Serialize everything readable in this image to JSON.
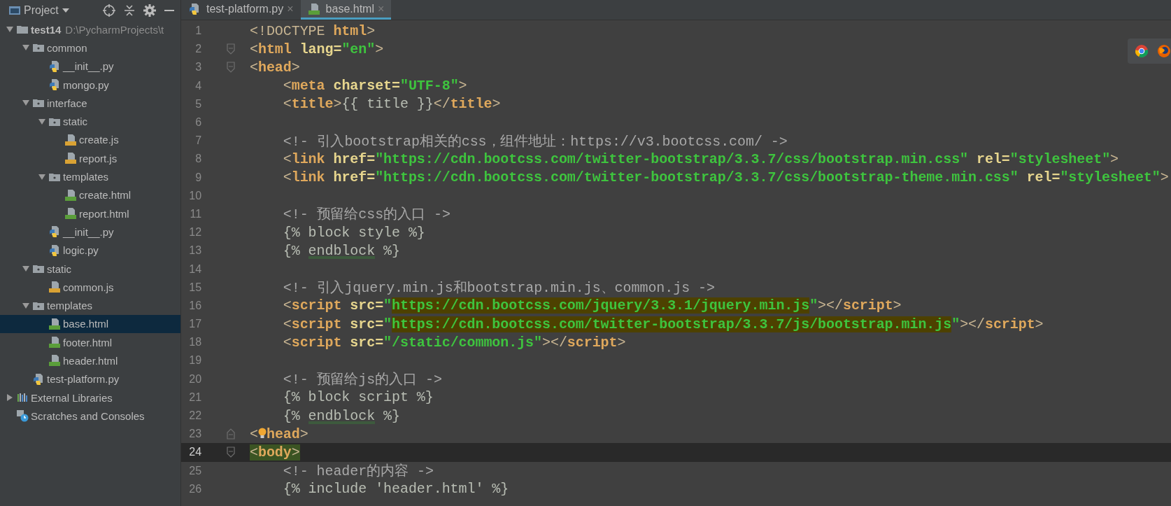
{
  "project_panel": {
    "title": "Project",
    "tree": [
      {
        "name": "test14",
        "kind": "root",
        "path": "D:\\PycharmProjects\\t",
        "expanded": true,
        "selected": false,
        "children": [
          {
            "name": "common",
            "kind": "folder",
            "expanded": true,
            "selected": false,
            "children": [
              {
                "name": "__init__.py",
                "kind": "py",
                "selected": false
              },
              {
                "name": "mongo.py",
                "kind": "py",
                "selected": false
              }
            ]
          },
          {
            "name": "interface",
            "kind": "folder",
            "expanded": true,
            "selected": false,
            "children": [
              {
                "name": "static",
                "kind": "folder",
                "expanded": true,
                "selected": false,
                "children": [
                  {
                    "name": "create.js",
                    "kind": "js",
                    "selected": false
                  },
                  {
                    "name": "report.js",
                    "kind": "js",
                    "selected": false
                  }
                ]
              },
              {
                "name": "templates",
                "kind": "folder",
                "expanded": true,
                "selected": false,
                "children": [
                  {
                    "name": "create.html",
                    "kind": "html",
                    "selected": false
                  },
                  {
                    "name": "report.html",
                    "kind": "html",
                    "selected": false
                  }
                ]
              },
              {
                "name": "__init__.py",
                "kind": "py",
                "selected": false
              },
              {
                "name": "logic.py",
                "kind": "py",
                "selected": false
              }
            ]
          },
          {
            "name": "static",
            "kind": "folder",
            "expanded": true,
            "selected": false,
            "children": [
              {
                "name": "common.js",
                "kind": "js",
                "selected": false
              }
            ]
          },
          {
            "name": "templates",
            "kind": "folder",
            "expanded": true,
            "selected": false,
            "children": [
              {
                "name": "base.html",
                "kind": "html",
                "selected": true
              },
              {
                "name": "footer.html",
                "kind": "html",
                "selected": false
              },
              {
                "name": "header.html",
                "kind": "html",
                "selected": false
              }
            ]
          },
          {
            "name": "test-platform.py",
            "kind": "py",
            "selected": false
          }
        ]
      },
      {
        "name": "External Libraries",
        "kind": "libraries",
        "expanded": false,
        "selected": false
      },
      {
        "name": "Scratches and Consoles",
        "kind": "scratches",
        "selected": false
      }
    ]
  },
  "editor": {
    "tabs": [
      {
        "label": "test-platform.py",
        "kind": "py",
        "selected": false,
        "close": "×"
      },
      {
        "label": "base.html",
        "kind": "html",
        "selected": true,
        "close": "×"
      }
    ],
    "lines": [
      {
        "number": "1",
        "current": false,
        "kind": "plain",
        "tokens": [
          {
            "text": "<!DOCTYPE ",
            "kind": "doctype"
          },
          {
            "text": "html",
            "kind": "tag"
          },
          {
            "text": ">",
            "kind": "p"
          }
        ]
      },
      {
        "number": "2",
        "current": false,
        "kind": "fold-start",
        "tokens": [
          {
            "text": "<",
            "kind": "p"
          },
          {
            "text": "html",
            "kind": "tag"
          },
          {
            "text": " lang=",
            "kind": "attr"
          },
          {
            "text": "\"en\"",
            "kind": "str"
          },
          {
            "text": ">",
            "kind": "p"
          }
        ]
      },
      {
        "number": "3",
        "current": false,
        "kind": "fold-start",
        "tokens": [
          {
            "text": "<",
            "kind": "p"
          },
          {
            "text": "head",
            "kind": "tag"
          },
          {
            "text": ">",
            "kind": "p"
          }
        ]
      },
      {
        "number": "4",
        "current": false,
        "kind": "plain",
        "tokens": [
          {
            "text": "    <",
            "kind": "p"
          },
          {
            "text": "meta",
            "kind": "tag"
          },
          {
            "text": " charset=",
            "kind": "attr"
          },
          {
            "text": "\"UTF-8\"",
            "kind": "str"
          },
          {
            "text": ">",
            "kind": "p"
          }
        ]
      },
      {
        "number": "5",
        "current": false,
        "kind": "plain",
        "tokens": [
          {
            "text": "    <",
            "kind": "p"
          },
          {
            "text": "title",
            "kind": "tag"
          },
          {
            "text": ">",
            "kind": "p"
          },
          {
            "text": "{{ title }}",
            "kind": "tpl"
          },
          {
            "text": "</",
            "kind": "p"
          },
          {
            "text": "title",
            "kind": "tag"
          },
          {
            "text": ">",
            "kind": "p"
          }
        ]
      },
      {
        "number": "6",
        "current": false,
        "kind": "plain"
      },
      {
        "number": "7",
        "current": false,
        "kind": "plain",
        "tokens": [
          {
            "text": "    <!- 引入bootstrap相关的css，组件地址：https://v3.bootcss.com/ ->",
            "kind": "cmt"
          }
        ]
      },
      {
        "number": "8",
        "current": false,
        "kind": "plain",
        "tokens": [
          {
            "text": "    <",
            "kind": "p"
          },
          {
            "text": "link",
            "kind": "tag"
          },
          {
            "text": " href=",
            "kind": "attr"
          },
          {
            "text": "\"https://cdn.bootcss.com/twitter-bootstrap/3.3.7/css/bootstrap.min.css\"",
            "kind": "str"
          },
          {
            "text": " rel=",
            "kind": "attr"
          },
          {
            "text": "\"stylesheet\"",
            "kind": "str"
          },
          {
            "text": ">",
            "kind": "p"
          }
        ]
      },
      {
        "number": "9",
        "current": false,
        "kind": "plain",
        "tokens": [
          {
            "text": "    <",
            "kind": "p"
          },
          {
            "text": "link",
            "kind": "tag"
          },
          {
            "text": " href=",
            "kind": "attr"
          },
          {
            "text": "\"https://cdn.bootcss.com/twitter-bootstrap/3.3.7/css/bootstrap-theme.min.css\"",
            "kind": "str"
          },
          {
            "text": " rel=",
            "kind": "attr"
          },
          {
            "text": "\"stylesheet\"",
            "kind": "str"
          },
          {
            "text": ">",
            "kind": "p"
          }
        ]
      },
      {
        "number": "10",
        "current": false,
        "kind": "plain"
      },
      {
        "number": "11",
        "current": false,
        "kind": "plain",
        "tokens": [
          {
            "text": "    <!- 预留给css的入口 ->",
            "kind": "cmt"
          }
        ]
      },
      {
        "number": "12",
        "current": false,
        "kind": "plain",
        "tokens": [
          {
            "text": "    {% block style %}",
            "kind": "tpl"
          }
        ]
      },
      {
        "number": "13",
        "current": false,
        "kind": "plain",
        "tokens": [
          {
            "text": "    {% ",
            "kind": "tpl"
          },
          {
            "text": "endblock",
            "kind": "tpl-warn"
          },
          {
            "text": " %}",
            "kind": "tpl"
          }
        ]
      },
      {
        "number": "14",
        "current": false,
        "kind": "plain"
      },
      {
        "number": "15",
        "current": false,
        "kind": "plain",
        "tokens": [
          {
            "text": "    <!- 引入jquery.min.js和bootstrap.min.js、common.js ->",
            "kind": "cmt"
          }
        ]
      },
      {
        "number": "16",
        "current": false,
        "kind": "plain",
        "tokens": [
          {
            "text": "    <",
            "kind": "p"
          },
          {
            "text": "script",
            "kind": "tag"
          },
          {
            "text": " src=",
            "kind": "attr"
          },
          {
            "text": "\"",
            "kind": "str"
          },
          {
            "text": "https://cdn.bootcss.com/jquery/3.3.1/jquery.min.js",
            "kind": "str-hl"
          },
          {
            "text": "\"",
            "kind": "str"
          },
          {
            "text": "></",
            "kind": "p"
          },
          {
            "text": "script",
            "kind": "tag"
          },
          {
            "text": ">",
            "kind": "p"
          }
        ]
      },
      {
        "number": "17",
        "current": false,
        "kind": "plain",
        "tokens": [
          {
            "text": "    <",
            "kind": "p"
          },
          {
            "text": "script",
            "kind": "tag"
          },
          {
            "text": " src=",
            "kind": "attr"
          },
          {
            "text": "\"",
            "kind": "str"
          },
          {
            "text": "https://cdn.bootcss.com/twitter-bootstrap/3.3.7/js/bootstrap.min.js",
            "kind": "str-hl"
          },
          {
            "text": "\"",
            "kind": "str"
          },
          {
            "text": "></",
            "kind": "p"
          },
          {
            "text": "script",
            "kind": "tag"
          },
          {
            "text": ">",
            "kind": "p"
          }
        ]
      },
      {
        "number": "18",
        "current": false,
        "kind": "plain",
        "tokens": [
          {
            "text": "    <",
            "kind": "p"
          },
          {
            "text": "script",
            "kind": "tag"
          },
          {
            "text": " src=",
            "kind": "attr"
          },
          {
            "text": "\"/static/common.js\"",
            "kind": "str"
          },
          {
            "text": "></",
            "kind": "p"
          },
          {
            "text": "script",
            "kind": "tag"
          },
          {
            "text": ">",
            "kind": "p"
          }
        ]
      },
      {
        "number": "19",
        "current": false,
        "kind": "plain"
      },
      {
        "number": "20",
        "current": false,
        "kind": "plain",
        "tokens": [
          {
            "text": "    <!- 预留给js的入口 ->",
            "kind": "cmt"
          }
        ]
      },
      {
        "number": "21",
        "current": false,
        "kind": "plain",
        "tokens": [
          {
            "text": "    {% block script %}",
            "kind": "tpl"
          }
        ]
      },
      {
        "number": "22",
        "current": false,
        "kind": "plain",
        "tokens": [
          {
            "text": "    {% ",
            "kind": "tpl"
          },
          {
            "text": "endblock",
            "kind": "tpl-warn"
          },
          {
            "text": " %}",
            "kind": "tpl"
          }
        ]
      },
      {
        "number": "23",
        "current": false,
        "kind": "fold-end",
        "lightbulb": true,
        "tokens": [
          {
            "text": "<",
            "kind": "p"
          },
          {
            "text": "head",
            "kind": "tag"
          },
          {
            "text": ">",
            "kind": "p"
          }
        ]
      },
      {
        "number": "24",
        "current": true,
        "kind": "fold-start",
        "tokens": [
          {
            "text": "<",
            "kind": "p-match"
          },
          {
            "text": "body",
            "kind": "tag-match"
          },
          {
            "text": ">",
            "kind": "p-match"
          }
        ]
      },
      {
        "number": "25",
        "current": false,
        "kind": "plain",
        "tokens": [
          {
            "text": "    <!- header的内容 ->",
            "kind": "cmt"
          }
        ]
      },
      {
        "number": "26",
        "current": false,
        "kind": "plain",
        "tokens": [
          {
            "text": "    {% include 'header.html' %}",
            "kind": "tpl"
          }
        ]
      }
    ]
  }
}
